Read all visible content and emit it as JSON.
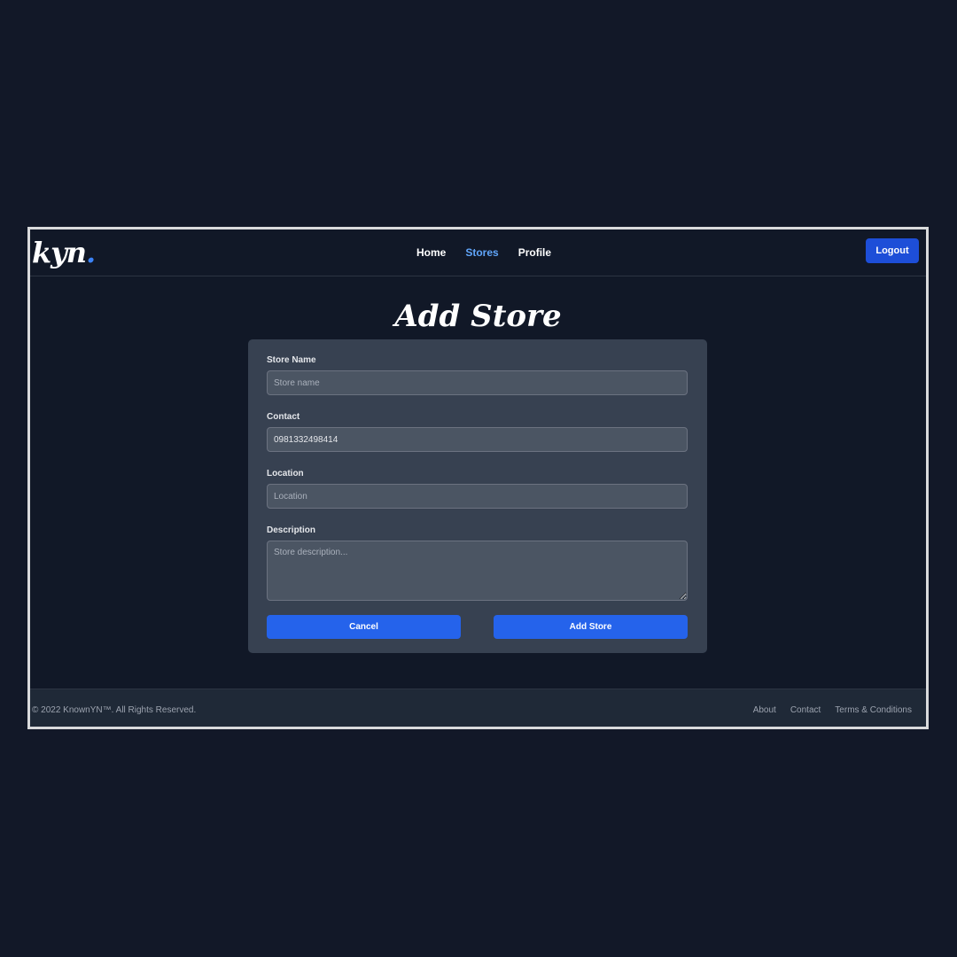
{
  "header": {
    "logo_text": "kyn",
    "logo_dot": ".",
    "nav": [
      "Home",
      "Stores",
      "Profile"
    ],
    "active_nav": "Stores",
    "logout_label": "Logout"
  },
  "page": {
    "title": "Add Store"
  },
  "form": {
    "store_name": {
      "label": "Store Name",
      "placeholder": "Store name",
      "value": ""
    },
    "contact": {
      "label": "Contact",
      "placeholder": "",
      "value": "0981332498414"
    },
    "location": {
      "label": "Location",
      "placeholder": "Location",
      "value": ""
    },
    "description": {
      "label": "Description",
      "placeholder": "Store description...",
      "value": ""
    },
    "cancel_label": "Cancel",
    "submit_label": "Add Store"
  },
  "footer": {
    "copyright": "© 2022 KnownYN™. All Rights Reserved.",
    "links": [
      "About",
      "Contact",
      "Terms & Conditions"
    ]
  },
  "colors": {
    "background": "#111827",
    "card": "#374151",
    "input": "#4b5563",
    "accent": "#2563eb",
    "active_nav": "#60a5fa"
  }
}
